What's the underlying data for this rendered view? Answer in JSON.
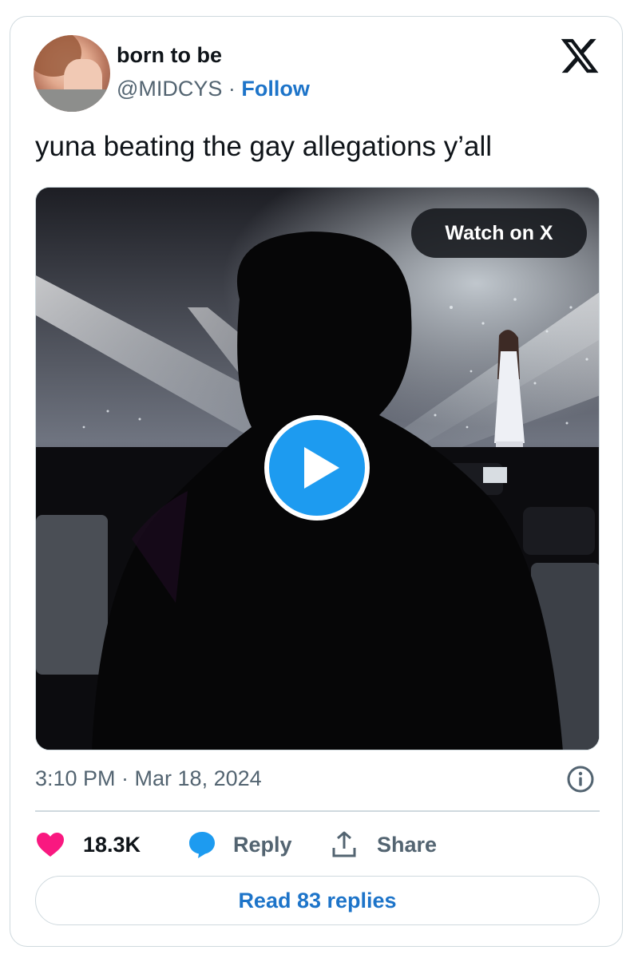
{
  "author": {
    "display_name": "born to be",
    "handle": "@MIDCYS",
    "separator": " · ",
    "follow_label": "Follow"
  },
  "tweet": {
    "text": "yuna beating the gay allegations y’all"
  },
  "media": {
    "watch_label": "Watch on X"
  },
  "meta": {
    "timestamp": "3:10 PM · Mar 18, 2024"
  },
  "actions": {
    "likes_count": "18.3K",
    "reply_label": "Reply",
    "share_label": "Share"
  },
  "footer": {
    "read_replies_label": "Read 83 replies"
  },
  "colors": {
    "link_blue": "#1d74c9",
    "play_blue": "#1d9bf0",
    "heart_pink": "#f91880",
    "muted_text": "#536471"
  },
  "icons": [
    "x-logo-icon",
    "play-icon",
    "info-icon",
    "heart-icon",
    "reply-bubble-icon",
    "share-icon"
  ]
}
